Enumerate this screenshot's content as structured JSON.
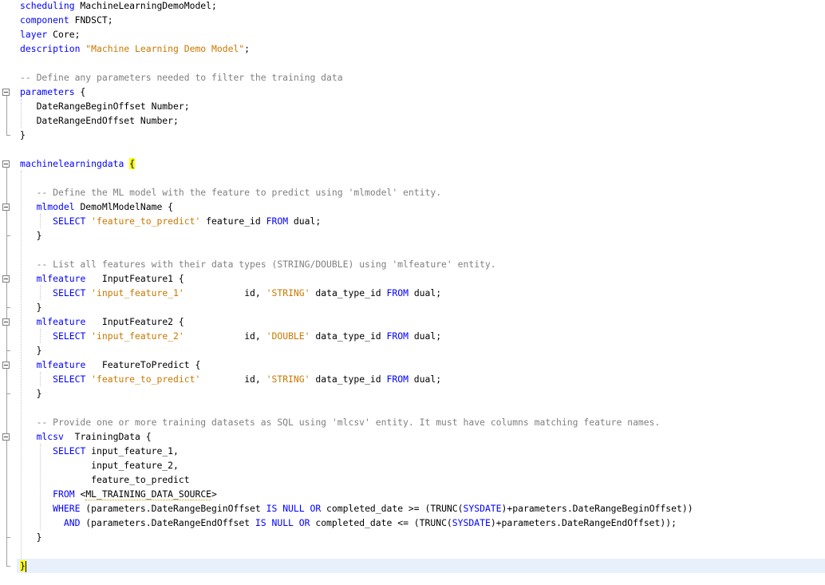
{
  "editor": {
    "lines": [
      [
        {
          "t": "scheduling",
          "c": "kw"
        },
        {
          "t": " MachineLearningDemoModel;",
          "c": ""
        }
      ],
      [
        {
          "t": "component",
          "c": "kw"
        },
        {
          "t": " FNDSCT;",
          "c": ""
        }
      ],
      [
        {
          "t": "layer",
          "c": "kw"
        },
        {
          "t": " Core;",
          "c": ""
        }
      ],
      [
        {
          "t": "description",
          "c": "kw"
        },
        {
          "t": " ",
          "c": ""
        },
        {
          "t": "\"Machine Learning Demo Model\"",
          "c": "str"
        },
        {
          "t": ";",
          "c": ""
        }
      ],
      [],
      [
        {
          "t": "-- Define any parameters needed to filter the training data",
          "c": "cm"
        }
      ],
      [
        {
          "t": "parameters",
          "c": "kw"
        },
        {
          "t": " {",
          "c": ""
        }
      ],
      [
        {
          "t": "   DateRangeBeginOffset Number;",
          "c": ""
        }
      ],
      [
        {
          "t": "   DateRangeEndOffset Number;",
          "c": ""
        }
      ],
      [
        {
          "t": "}",
          "c": ""
        }
      ],
      [],
      [
        {
          "t": "machinelearningdata",
          "c": "kw"
        },
        {
          "t": " ",
          "c": ""
        },
        {
          "t": "{",
          "c": "brace-hl"
        }
      ],
      [],
      [
        {
          "t": "   -- Define the ML model with the feature to predict using 'mlmodel' entity.",
          "c": "cm"
        }
      ],
      [
        {
          "t": "   ",
          "c": ""
        },
        {
          "t": "mlmodel",
          "c": "kw"
        },
        {
          "t": " DemoMlModelName {",
          "c": ""
        }
      ],
      [
        {
          "t": "      ",
          "c": ""
        },
        {
          "t": "SELECT",
          "c": "kw"
        },
        {
          "t": " ",
          "c": ""
        },
        {
          "t": "'feature_to_predict'",
          "c": "str"
        },
        {
          "t": " feature_id ",
          "c": ""
        },
        {
          "t": "FROM",
          "c": "kw"
        },
        {
          "t": " dual;",
          "c": ""
        }
      ],
      [
        {
          "t": "   }",
          "c": ""
        }
      ],
      [],
      [
        {
          "t": "   -- List all features with their data types (STRING/DOUBLE) using 'mlfeature' entity.",
          "c": "cm"
        }
      ],
      [
        {
          "t": "   ",
          "c": ""
        },
        {
          "t": "mlfeature",
          "c": "kw"
        },
        {
          "t": "   InputFeature1 {",
          "c": ""
        }
      ],
      [
        {
          "t": "      ",
          "c": ""
        },
        {
          "t": "SELECT",
          "c": "kw"
        },
        {
          "t": " ",
          "c": ""
        },
        {
          "t": "'input_feature_1'",
          "c": "str"
        },
        {
          "t": "           id, ",
          "c": ""
        },
        {
          "t": "'STRING'",
          "c": "str"
        },
        {
          "t": " data_type_id ",
          "c": ""
        },
        {
          "t": "FROM",
          "c": "kw"
        },
        {
          "t": " dual;",
          "c": ""
        }
      ],
      [
        {
          "t": "   }",
          "c": ""
        }
      ],
      [
        {
          "t": "   ",
          "c": ""
        },
        {
          "t": "mlfeature",
          "c": "kw"
        },
        {
          "t": "   InputFeature2 {",
          "c": ""
        }
      ],
      [
        {
          "t": "      ",
          "c": ""
        },
        {
          "t": "SELECT",
          "c": "kw"
        },
        {
          "t": " ",
          "c": ""
        },
        {
          "t": "'input_feature_2'",
          "c": "str"
        },
        {
          "t": "           id, ",
          "c": ""
        },
        {
          "t": "'DOUBLE'",
          "c": "str"
        },
        {
          "t": " data_type_id ",
          "c": ""
        },
        {
          "t": "FROM",
          "c": "kw"
        },
        {
          "t": " dual;",
          "c": ""
        }
      ],
      [
        {
          "t": "   }",
          "c": ""
        }
      ],
      [
        {
          "t": "   ",
          "c": ""
        },
        {
          "t": "mlfeature",
          "c": "kw"
        },
        {
          "t": "   FeatureToPredict {",
          "c": ""
        }
      ],
      [
        {
          "t": "      ",
          "c": ""
        },
        {
          "t": "SELECT",
          "c": "kw"
        },
        {
          "t": " ",
          "c": ""
        },
        {
          "t": "'feature_to_predict'",
          "c": "str"
        },
        {
          "t": "        id, ",
          "c": ""
        },
        {
          "t": "'STRING'",
          "c": "str"
        },
        {
          "t": " data_type_id ",
          "c": ""
        },
        {
          "t": "FROM",
          "c": "kw"
        },
        {
          "t": " dual;",
          "c": ""
        }
      ],
      [
        {
          "t": "   }",
          "c": ""
        }
      ],
      [],
      [
        {
          "t": "   -- Provide one or more training datasets as SQL using 'mlcsv' entity. It must have columns matching feature names.",
          "c": "cm"
        }
      ],
      [
        {
          "t": "   ",
          "c": ""
        },
        {
          "t": "mlcsv",
          "c": "kw"
        },
        {
          "t": "  TrainingData {",
          "c": ""
        }
      ],
      [
        {
          "t": "      ",
          "c": ""
        },
        {
          "t": "SELECT",
          "c": "kw"
        },
        {
          "t": " input_feature_1,",
          "c": ""
        }
      ],
      [
        {
          "t": "             input_feature_2,",
          "c": ""
        }
      ],
      [
        {
          "t": "             feature_to_predict",
          "c": ""
        }
      ],
      [
        {
          "t": "      ",
          "c": ""
        },
        {
          "t": "FROM",
          "c": "kw"
        },
        {
          "t": " <",
          "c": ""
        },
        {
          "t": "ML_TRAINING_DATA_SOURCE",
          "c": "squig"
        },
        {
          "t": ">",
          "c": ""
        }
      ],
      [
        {
          "t": "      ",
          "c": ""
        },
        {
          "t": "WHERE",
          "c": "kw"
        },
        {
          "t": " (parameters.DateRangeBeginOffset ",
          "c": ""
        },
        {
          "t": "IS NULL OR",
          "c": "kw"
        },
        {
          "t": " completed_date >= (TRUNC(",
          "c": ""
        },
        {
          "t": "SYSDATE",
          "c": "kw"
        },
        {
          "t": ")+parameters.DateRangeBeginOffset))",
          "c": ""
        }
      ],
      [
        {
          "t": "        ",
          "c": ""
        },
        {
          "t": "AND",
          "c": "kw"
        },
        {
          "t": " (parameters.DateRangeEndOffset ",
          "c": ""
        },
        {
          "t": "IS NULL OR",
          "c": "kw"
        },
        {
          "t": " completed_date <= (TRUNC(",
          "c": ""
        },
        {
          "t": "SYSDATE",
          "c": "kw"
        },
        {
          "t": ")+parameters.DateRangeEndOffset));",
          "c": ""
        }
      ],
      [
        {
          "t": "   }",
          "c": ""
        }
      ],
      [],
      [
        {
          "t": "}",
          "c": "brace-hl"
        },
        {
          "t": "",
          "c": "caret"
        }
      ]
    ]
  },
  "colors": {
    "keyword": "#0000ff",
    "string": "#c87800",
    "comment": "#808080",
    "brace_highlight": "#ffff00",
    "current_line": "#e8f0fb"
  }
}
